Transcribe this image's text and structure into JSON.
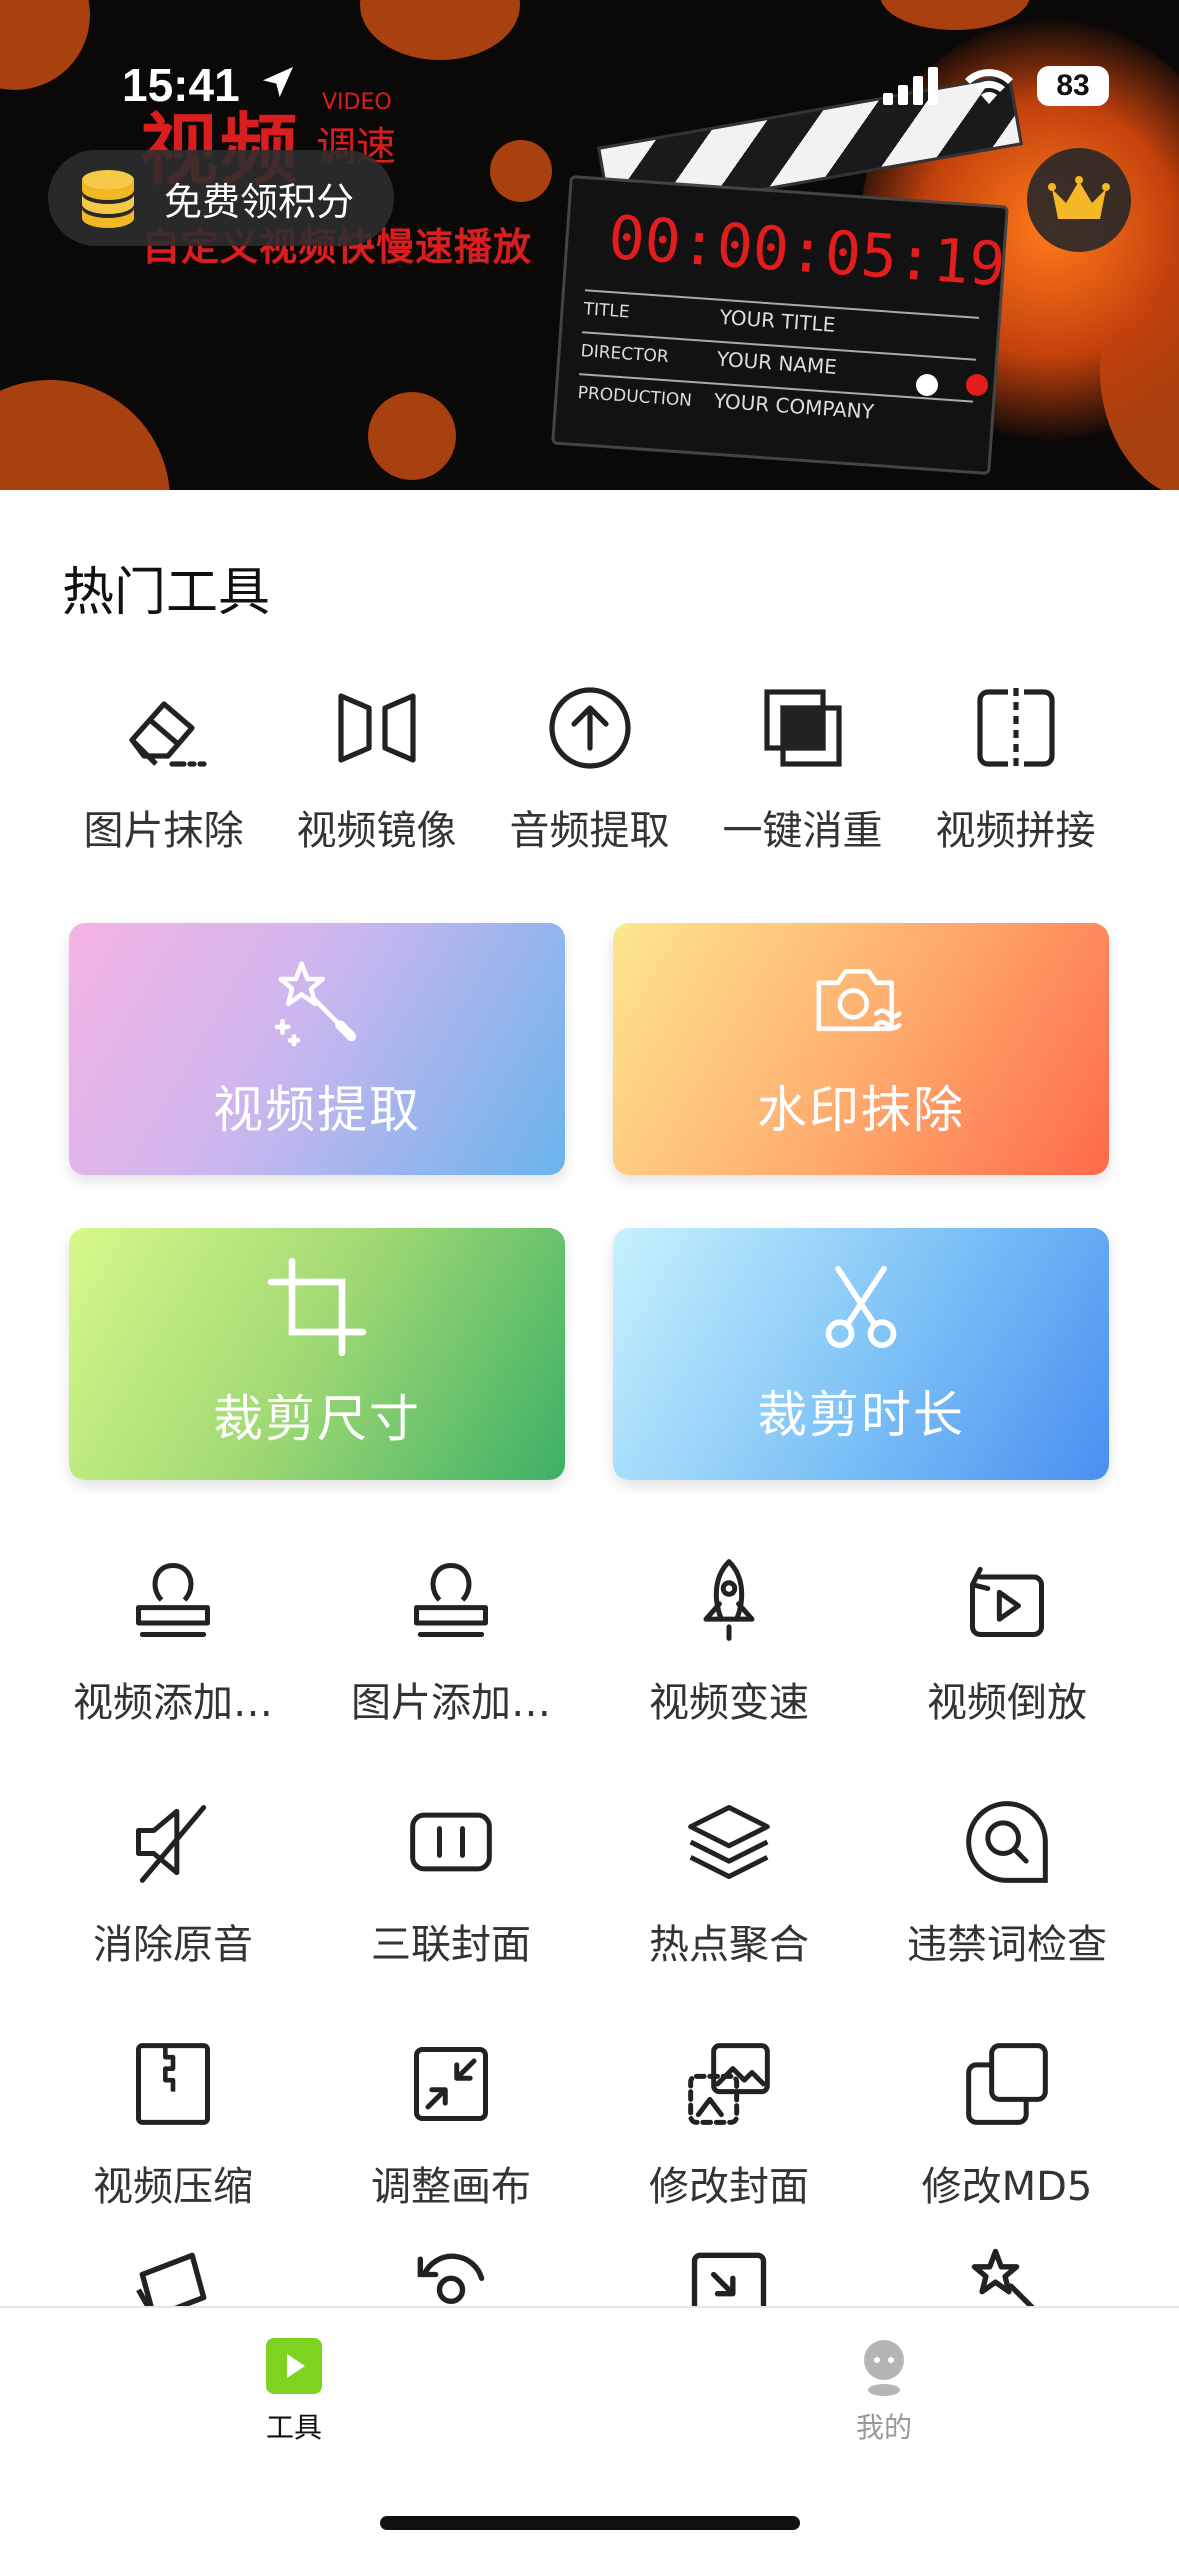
{
  "status_bar": {
    "time": "15:41",
    "battery": "83"
  },
  "banner": {
    "title": "视频",
    "video_word": "VIDEO",
    "speed_word": "调速",
    "subtitle": "自定义视频快慢速播放",
    "clapper": {
      "timecode": "00:00:05:19",
      "rows": [
        {
          "key": "TITLE",
          "value": "YOUR TITLE"
        },
        {
          "key": "DIRECTOR",
          "value": "YOUR NAME"
        },
        {
          "key": "PRODUCTION",
          "value": "YOUR COMPANY"
        }
      ]
    },
    "points_button": "免费领积分",
    "carousel_active_color": "#e11d1d",
    "carousel_inactive_color": "#ffffff"
  },
  "section_title": "热门工具",
  "top_tools": [
    {
      "label": "图片抹除",
      "icon": "eraser-icon"
    },
    {
      "label": "视频镜像",
      "icon": "mirror-icon"
    },
    {
      "label": "音频提取",
      "icon": "upload-circle-icon"
    },
    {
      "label": "一键消重",
      "icon": "layers-square-icon"
    },
    {
      "label": "视频拼接",
      "icon": "split-icon"
    }
  ],
  "cards": [
    {
      "label": "视频提取",
      "icon": "magic-wand-icon"
    },
    {
      "label": "水印抹除",
      "icon": "camera-icon"
    },
    {
      "label": "裁剪尺寸",
      "icon": "crop-icon"
    },
    {
      "label": "裁剪时长",
      "icon": "scissors-icon"
    }
  ],
  "grid_tools": [
    {
      "label": "视频添加…",
      "icon": "stamp-icon"
    },
    {
      "label": "图片添加…",
      "icon": "stamp-icon"
    },
    {
      "label": "视频变速",
      "icon": "rocket-icon"
    },
    {
      "label": "视频倒放",
      "icon": "reverse-play-icon"
    },
    {
      "label": "消除原音",
      "icon": "mute-icon"
    },
    {
      "label": "三联封面",
      "icon": "triptych-icon"
    },
    {
      "label": "热点聚合",
      "icon": "stack-icon"
    },
    {
      "label": "违禁词检查",
      "icon": "search-chat-icon"
    },
    {
      "label": "视频压缩",
      "icon": "zip-icon"
    },
    {
      "label": "调整画布",
      "icon": "shrink-icon"
    },
    {
      "label": "修改封面",
      "icon": "image-swap-icon"
    },
    {
      "label": "修改MD5",
      "icon": "copy-icon"
    }
  ],
  "tabbar": {
    "tools_label": "工具",
    "mine_label": "我的",
    "active_color": "#111111",
    "inactive_color": "#999999",
    "accent": "#7ed321"
  }
}
